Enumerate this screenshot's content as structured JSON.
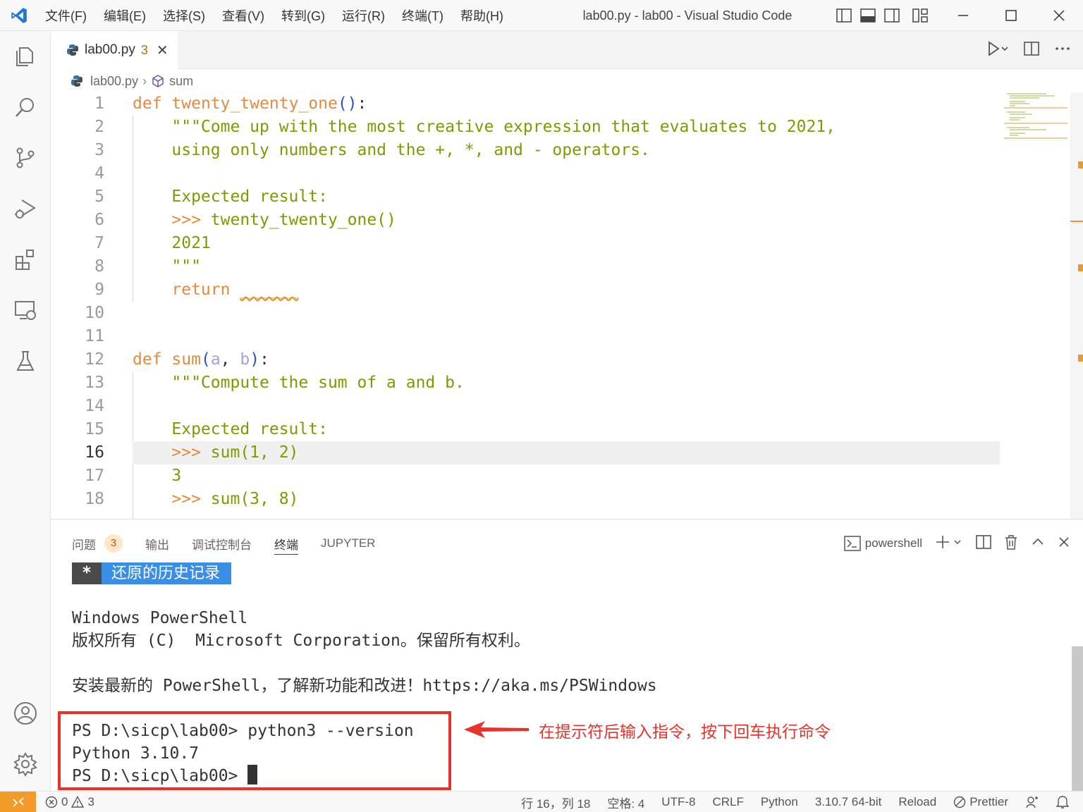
{
  "window": {
    "title": "lab00.py - lab00 - Visual Studio Code",
    "menu": [
      "文件(F)",
      "编辑(E)",
      "选择(S)",
      "查看(V)",
      "转到(G)",
      "运行(R)",
      "终端(T)",
      "帮助(H)"
    ]
  },
  "tab": {
    "label": "lab00.py",
    "problems": "3"
  },
  "breadcrumb": {
    "file": "lab00.py",
    "symbol": "sum"
  },
  "editor": {
    "line_numbers": [
      "1",
      "2",
      "3",
      "4",
      "5",
      "6",
      "7",
      "8",
      "9",
      "10",
      "11",
      "12",
      "13",
      "14",
      "15",
      "16",
      "17",
      "18"
    ],
    "current_line": "16",
    "tokens": {
      "l1_def": "def",
      "l1_name": "twenty_twenty_one",
      "l1_open": "(",
      "l1_close": ")",
      "l1_colon": ":",
      "l2": "    \"\"\"Come up with the most creative expression that evaluates to 2021,",
      "l3": "    using only numbers and the +, *, and - operators.",
      "l5": "    Expected result:",
      "l6_prompt": "    >>>",
      "l6_call": " twenty_twenty_one()",
      "l7": "    2021",
      "l8": "    \"\"\"",
      "l9_ret": "    return",
      "l9_blank": "______",
      "l12_def": "def",
      "l12_name": "sum",
      "l12_open": "(",
      "l12_a": "a",
      "l12_comma": ", ",
      "l12_b": "b",
      "l12_close": ")",
      "l12_colon": ":",
      "l13": "    \"\"\"Compute the sum of a and b.",
      "l15": "    Expected result:",
      "l16_prompt": "    >>>",
      "l16_call": " sum(1, 2)",
      "l17": "    3",
      "l18_prompt": "    >>>",
      "l18_call": " sum(3, 8)"
    }
  },
  "panel": {
    "tabs": [
      "问题",
      "输出",
      "调试控制台",
      "终端",
      "JUPYTER"
    ],
    "problems_badge": "3",
    "active_tab": "终端",
    "shell_label": "powershell"
  },
  "terminal": {
    "restore_star": "*",
    "restore_text": "还原的历史记录",
    "lines": [
      "Windows PowerShell",
      "版权所有 (C)  Microsoft Corporation。保留所有权利。",
      "安装最新的 PowerShell，了解新功能和改进！https://aka.ms/PSWindows"
    ],
    "prompt1": "PS D:\\sicp\\lab00> ",
    "command1": "python3 --version",
    "output1": "Python 3.10.7",
    "prompt2": "PS D:\\sicp\\lab00> "
  },
  "annotation": {
    "text": "在提示符后输入指令，按下回车执行命令",
    "color": "#e8332a"
  },
  "statusbar": {
    "errors": "0",
    "warnings": "3",
    "position": "行 16，列 18",
    "indent": "空格: 4",
    "encoding": "UTF-8",
    "eol": "CRLF",
    "language": "Python",
    "interpreter": "3.10.7 64-bit",
    "reload": "Reload",
    "prettier": "Prettier"
  },
  "colors": {
    "accent": "#3a8ee6",
    "remote": "#f29b28",
    "keyword": "#e58a3c",
    "docstring": "#7f9a00"
  }
}
